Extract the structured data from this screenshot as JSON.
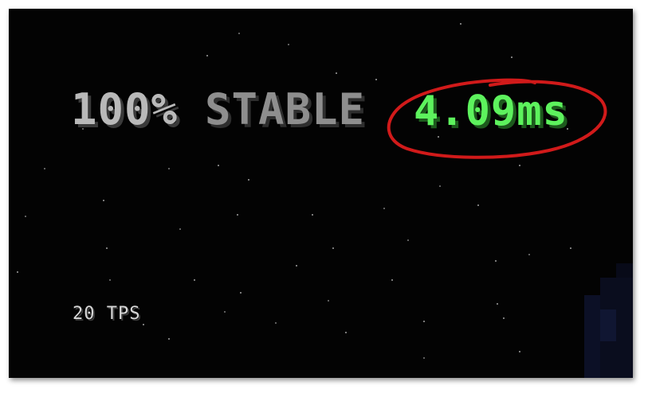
{
  "hud": {
    "stable_percent": "100%",
    "stable_word": "STABLE",
    "ms_value": "4.09ms",
    "tps": "20 TPS"
  },
  "colors": {
    "sky": "#030303",
    "stable_percent": "#b9b9b9",
    "stable_word": "#8e8e8e",
    "ms_value": "#5df25d",
    "highlight_circle": "#d11a1a",
    "tps": "#d6d6d6"
  },
  "icons": {
    "highlight": "red-hand-drawn-circle"
  }
}
